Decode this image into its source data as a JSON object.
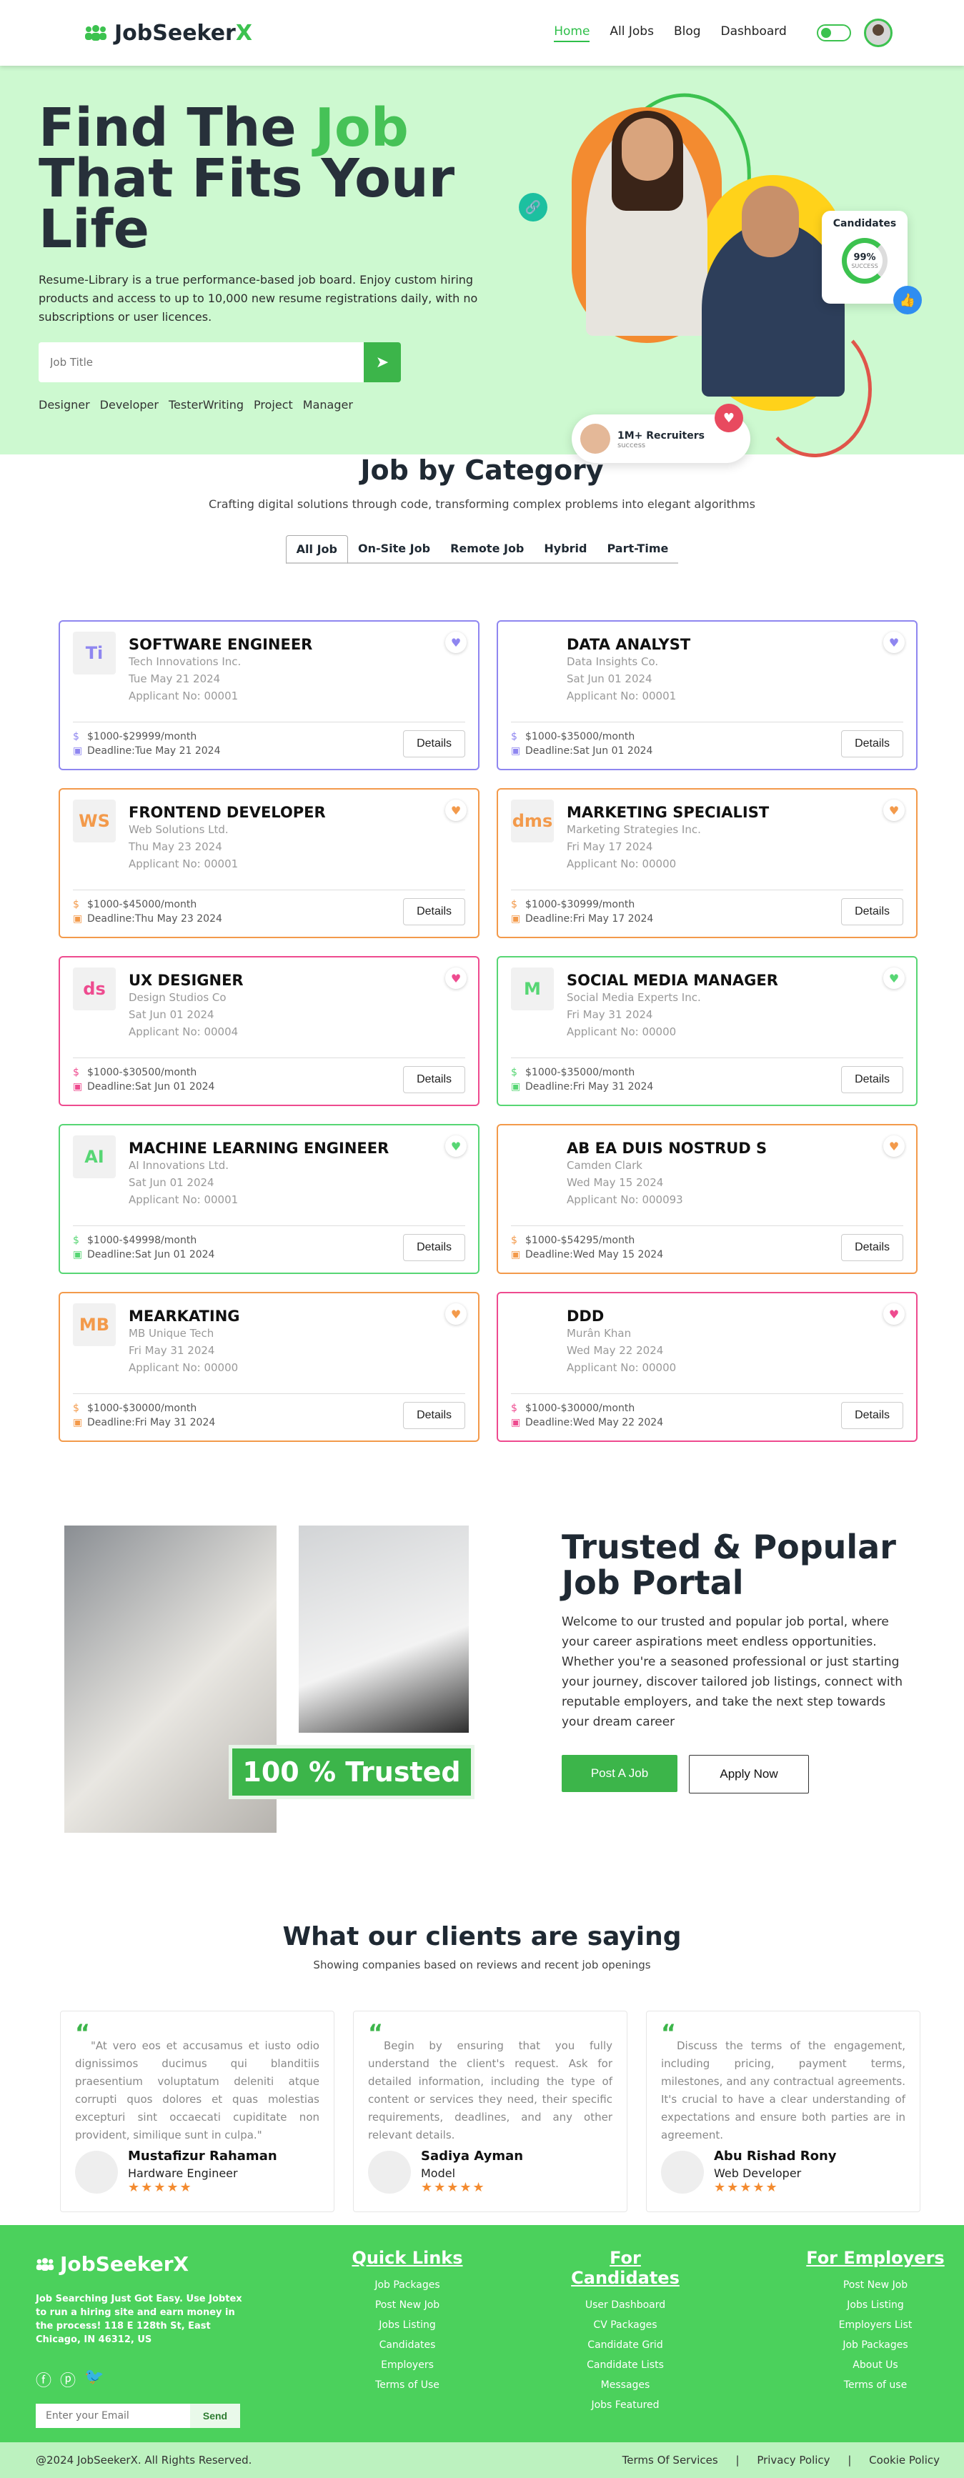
{
  "nav": {
    "brand_prefix": "JobSeeker",
    "brand_suffix": "X",
    "links": [
      "Home",
      "All Jobs",
      "Blog",
      "Dashboard"
    ]
  },
  "hero": {
    "title_1": "Find The ",
    "title_highlight": "Job",
    "title_2": "That Fits Your Life",
    "desc": "Resume-Library is a true performance-based job board. Enjoy custom hiring products and access to up to 10,000 new resume registrations daily, with no subscriptions or user licences.",
    "search_placeholder": "Job Title",
    "tags": [
      "Designer",
      "Developer",
      "TesterWriting",
      "Project",
      "Manager"
    ],
    "candidates_label": "Candidates",
    "candidates_value": "99%",
    "candidates_sub": "SUCCESS",
    "recruiters_title": "1M+ Recruiters",
    "recruiters_sub": "success"
  },
  "category": {
    "title": "Job by Category",
    "subtitle": "Crafting digital solutions through code, transforming complex problems into elegant algorithms",
    "tabs": [
      "All Job",
      "On-Site Job",
      "Remote Job",
      "Hybrid",
      "Part-Time"
    ],
    "details_label": "Details",
    "jobs": [
      {
        "title": "SOFTWARE ENGINEER",
        "company": "Tech Innovations Inc.",
        "date": "Tue May 21 2024",
        "applicant": "Applicant No: 00001",
        "salary": "$1000-$29999/month",
        "deadline": "Deadline:Tue May 21 2024",
        "color": "#8f86f0",
        "logo": "Ti"
      },
      {
        "title": "DATA ANALYST",
        "company": "Data Insights Co.",
        "date": "Sat Jun 01 2024",
        "applicant": "Applicant No: 00001",
        "salary": "$1000-$35000/month",
        "deadline": "Deadline:Sat Jun 01 2024",
        "color": "#8f86f0",
        "logo": ""
      },
      {
        "title": "FRONTEND DEVELOPER",
        "company": "Web Solutions Ltd.",
        "date": "Thu May 23 2024",
        "applicant": "Applicant No: 00001",
        "salary": "$1000-$45000/month",
        "deadline": "Deadline:Thu May 23 2024",
        "color": "#f39a4b",
        "logo": "WS"
      },
      {
        "title": "MARKETING SPECIALIST",
        "company": "Marketing Strategies Inc.",
        "date": "Fri May 17 2024",
        "applicant": "Applicant No: 00000",
        "salary": "$1000-$30999/month",
        "deadline": "Deadline:Fri May 17 2024",
        "color": "#f39a4b",
        "logo": "dms"
      },
      {
        "title": "UX DESIGNER",
        "company": "Design Studios Co",
        "date": "Sat Jun 01 2024",
        "applicant": "Applicant No: 00004",
        "salary": "$1000-$30500/month",
        "deadline": "Deadline:Sat Jun 01 2024",
        "color": "#ee4b8f",
        "logo": "ds"
      },
      {
        "title": "SOCIAL MEDIA MANAGER",
        "company": "Social Media Experts Inc.",
        "date": "Fri May 31 2024",
        "applicant": "Applicant No: 00000",
        "salary": "$1000-$35000/month",
        "deadline": "Deadline:Fri May 31 2024",
        "color": "#57d674",
        "logo": "M"
      },
      {
        "title": "MACHINE LEARNING ENGINEER",
        "company": "AI Innovations Ltd.",
        "date": "Sat Jun 01 2024",
        "applicant": "Applicant No: 00001",
        "salary": "$1000-$49998/month",
        "deadline": "Deadline:Sat Jun 01 2024",
        "color": "#57d674",
        "logo": "AI"
      },
      {
        "title": "AB EA DUIS NOSTRUD S",
        "company": "Camden Clark",
        "date": "Wed May 15 2024",
        "applicant": "Applicant No: 000093",
        "salary": "$1000-$54295/month",
        "deadline": "Deadline:Wed May 15 2024",
        "color": "#f39a4b",
        "logo": ""
      },
      {
        "title": "MEARKATING",
        "company": "MB Unique Tech",
        "date": "Fri May 31 2024",
        "applicant": "Applicant No: 00000",
        "salary": "$1000-$30000/month",
        "deadline": "Deadline:Fri May 31 2024",
        "color": "#f39a4b",
        "logo": "MB"
      },
      {
        "title": "DDD",
        "company": "Murân Khan",
        "date": "Wed May 22 2024",
        "applicant": "Applicant No: 00000",
        "salary": "$1000-$30000/month",
        "deadline": "Deadline:Wed May 22 2024",
        "color": "#ee4b8f",
        "logo": ""
      }
    ]
  },
  "trusted": {
    "badge": "100 % Trusted",
    "title": "Trusted & Popular Job Portal",
    "desc": "Welcome to our trusted and popular job portal, where your career aspirations meet endless opportunities. Whether you're a seasoned professional or just starting your journey, discover tailored job listings, connect with reputable employers, and take the next step towards your dream career",
    "post_btn": "Post A Job",
    "apply_btn": "Apply Now"
  },
  "clients": {
    "title": "What our clients are saying",
    "subtitle": "Showing companies based on reviews and recent job openings",
    "reviews": [
      {
        "text": "\"At vero eos et accusamus et iusto odio dignissimos ducimus qui blanditiis praesentium voluptatum deleniti atque corrupti quos dolores et quas molestias excepturi sint occaecati cupiditate non provident, similique sunt in culpa.\"",
        "name": "Mustafizur Rahaman",
        "role": "Hardware Engineer"
      },
      {
        "text": "Begin by ensuring that you fully understand the client's request. Ask for detailed information, including the type of content or services they need, their specific requirements, deadlines, and any other relevant details.",
        "name": "Sadiya Ayman",
        "role": "Model"
      },
      {
        "text": "Discuss the terms of the engagement, including pricing, payment terms, milestones, and any contractual agreements. It's crucial to have a clear understanding of expectations and ensure both parties are in agreement.",
        "name": "Abu Rishad Rony",
        "role": "Web Developer"
      }
    ],
    "stars": "★★★★★"
  },
  "footer": {
    "brand": "JobSeekerX",
    "desc": "Job Searching Just Got Easy. Use Jobtex to run a hiring site and earn money in the process! 118 E 128th St, East Chicago, IN 46312, US",
    "email_placeholder": "Enter your Email",
    "send": "Send",
    "cols": [
      {
        "title": "Quick Links",
        "items": [
          "Job Packages",
          "Post New Job",
          "Jobs Listing",
          "Candidates",
          "Employers",
          "Terms of Use"
        ]
      },
      {
        "title": "For Candidates",
        "items": [
          "User Dashboard",
          "CV Packages",
          "Candidate Grid",
          "Candidate Lists",
          "Messages",
          "Jobs Featured"
        ]
      },
      {
        "title": "For Employers",
        "items": [
          "Post New Job",
          "Jobs Listing",
          "Employers List",
          "Job Packages",
          "About Us",
          "Terms of use"
        ]
      }
    ],
    "copyright": "@2024 JobSeekerX. All Rights Reserved.",
    "bottom_links": [
      "Terms Of Services",
      "|",
      "Privacy Policy",
      "|",
      "Cookie Policy"
    ]
  }
}
